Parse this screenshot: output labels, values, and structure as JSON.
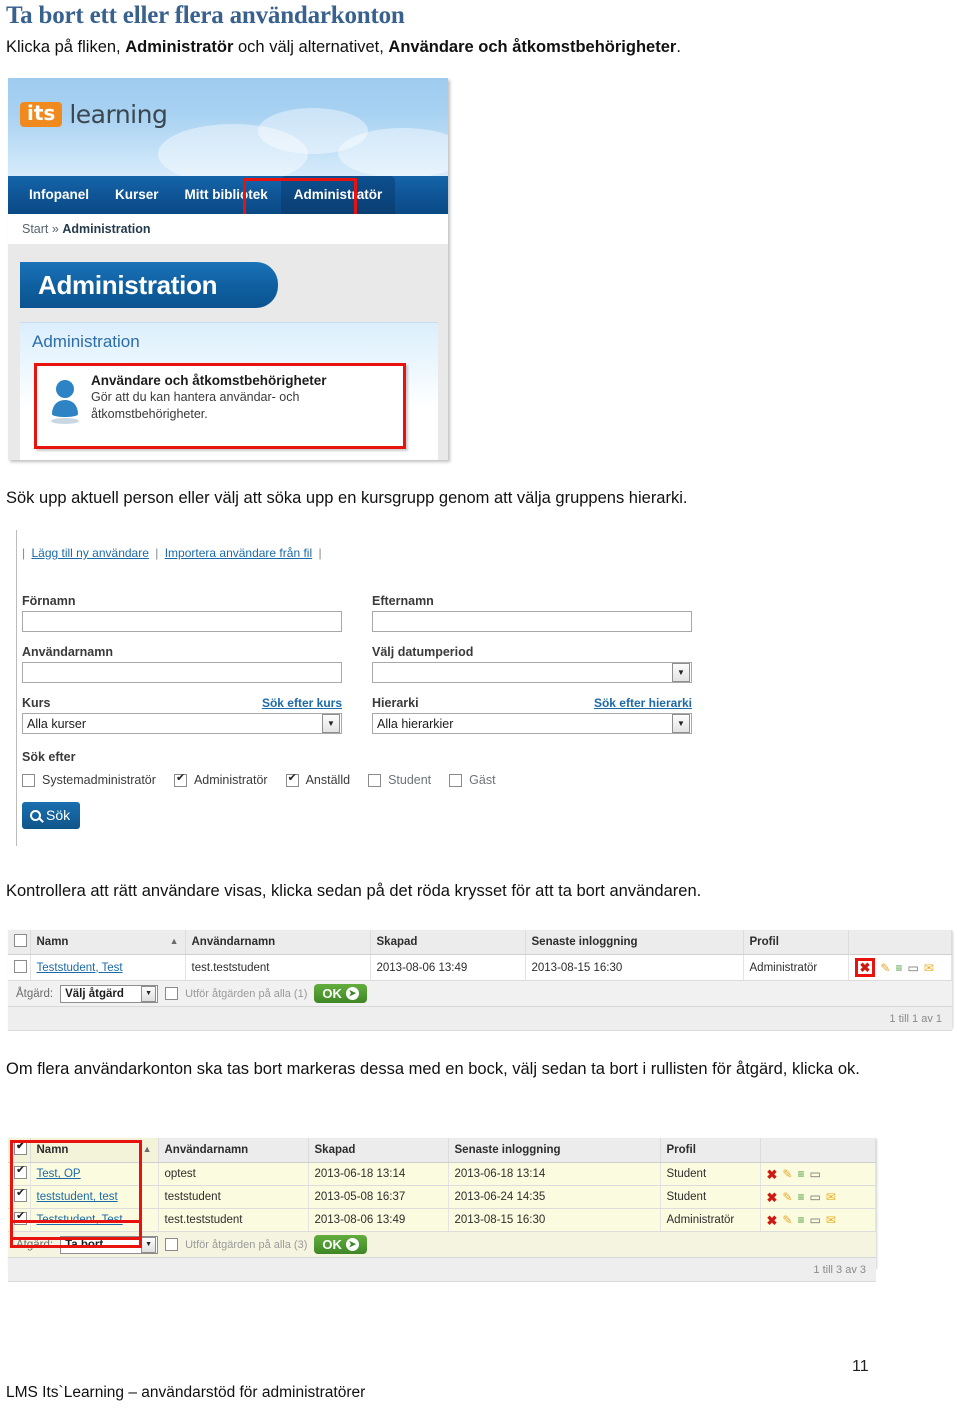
{
  "document": {
    "title": "Ta bort ett eller flera användarkonton",
    "paragraph_1_parts": [
      "Klicka på fliken, ",
      "Administratör",
      " och välj alternativet, ",
      "Användare och åtkomstbehörigheter",
      "."
    ],
    "paragraph_2": "Sök upp aktuell person eller välj att söka upp en kursgrupp genom att välja gruppens hierarki.",
    "paragraph_3": "Kontrollera att rätt användare visas, klicka sedan på det röda krysset för att ta bort användaren.",
    "paragraph_4": "Om flera användarkonton ska tas bort markeras dessa med en bock, välj sedan ta bort i rullisten för åtgärd, klicka ok.",
    "footer": "LMS Its`Learning – användarstöd för administratörer",
    "page_number": "11",
    "heading_color": "#38618e"
  },
  "screenshot_admin": {
    "logo_badge": "its",
    "logo_word": "learning",
    "nav_items": [
      {
        "label": "Infopanel",
        "active": false
      },
      {
        "label": "Kurser",
        "active": false
      },
      {
        "label": "Mitt bibliotek",
        "active": false
      },
      {
        "label": "Administratör",
        "active": true
      }
    ],
    "breadcrumb_start": "Start",
    "breadcrumb_sep": "»",
    "breadcrumb_current": "Administration",
    "page_title": "Administration",
    "panel_heading": "Administration",
    "card_title": "Användare och åtkomstbehörigheter",
    "card_desc_line1": "Gör att du kan hantera användar- och",
    "card_desc_line2": "åtkomstbehörigheter.",
    "highlight_color": "#e8120e",
    "nav_bg": "#0f5596",
    "brand_orange": "#f08a1c"
  },
  "screenshot_search": {
    "toolbar_links": [
      "Lägg till ny användare",
      "Importera användare från fil"
    ],
    "fields": {
      "fornamn_label": "Förnamn",
      "fornamn_value": "",
      "efternamn_label": "Efternamn",
      "efternamn_value": "",
      "anvandarnamn_label": "Användarnamn",
      "anvandarnamn_value": "",
      "datumperiod_label": "Välj datumperiod",
      "datumperiod_value": "",
      "kurs_label": "Kurs",
      "kurs_link": "Sök efter kurs",
      "kurs_value": "Alla kurser",
      "hierarki_label": "Hierarki",
      "hierarki_link": "Sök efter hierarki",
      "hierarki_value": "Alla hierarkier"
    },
    "sok_efter_label": "Sök efter",
    "checkboxes": [
      {
        "label": "Systemadministratör",
        "checked": false
      },
      {
        "label": "Administratör",
        "checked": true
      },
      {
        "label": "Anställd",
        "checked": true
      },
      {
        "label": "Student",
        "checked": false
      },
      {
        "label": "Gäst",
        "checked": false
      }
    ],
    "search_button": "Sök",
    "search_icon": "magnifier-icon"
  },
  "table_single": {
    "columns": [
      "",
      "Namn",
      "Användarnamn",
      "Skapad",
      "Senaste inloggning",
      "Profil",
      ""
    ],
    "sort_column": "Namn",
    "sort_direction": "ascending",
    "rows": [
      {
        "selected": false,
        "namn": "Teststudent, Test",
        "anvandarnamn": "test.teststudent",
        "skapad": "2013-08-06 13:49",
        "senaste_inloggning": "2013-08-15 16:30",
        "profil": "Administratör",
        "actions": [
          "delete-icon",
          "edit-icon",
          "list-icon",
          "card-icon",
          "mail-icon"
        ],
        "delete_highlighted": true
      }
    ],
    "action_label": "Åtgärd:",
    "action_value": "Välj åtgärd",
    "apply_all_label": "Utför åtgärden på alla (1)",
    "apply_all_checked": false,
    "ok_label": "OK",
    "pager_text": "1 till 1 av 1"
  },
  "table_multi": {
    "columns": [
      "",
      "Namn",
      "Användarnamn",
      "Skapad",
      "Senaste inloggning",
      "Profil",
      ""
    ],
    "sort_column": "Namn",
    "sort_direction": "ascending",
    "header_checkbox_checked": true,
    "rows": [
      {
        "selected": true,
        "namn": "Test, OP",
        "anvandarnamn": "optest",
        "skapad": "2013-06-18 13:14",
        "senaste_inloggning": "2013-06-18 13:14",
        "profil": "Student",
        "actions": [
          "delete-icon",
          "edit-icon",
          "list-icon",
          "card-icon"
        ]
      },
      {
        "selected": true,
        "namn": "teststudent, test",
        "anvandarnamn": "teststudent",
        "skapad": "2013-05-08 16:37",
        "senaste_inloggning": "2013-06-24 14:35",
        "profil": "Student",
        "actions": [
          "delete-icon",
          "edit-icon",
          "list-icon",
          "card-icon",
          "mail-icon"
        ]
      },
      {
        "selected": true,
        "namn": "Teststudent, Test",
        "anvandarnamn": "test.teststudent",
        "skapad": "2013-08-06 13:49",
        "senaste_inloggning": "2013-08-15 16:30",
        "profil": "Administratör",
        "actions": [
          "delete-icon",
          "edit-icon",
          "list-icon",
          "card-icon",
          "mail-icon"
        ]
      }
    ],
    "action_label": "Åtgärd:",
    "action_value": "Ta bort",
    "apply_all_label": "Utför åtgärden på alla (3)",
    "apply_all_checked": false,
    "ok_label": "OK",
    "pager_text": "1 till 3 av 3"
  }
}
